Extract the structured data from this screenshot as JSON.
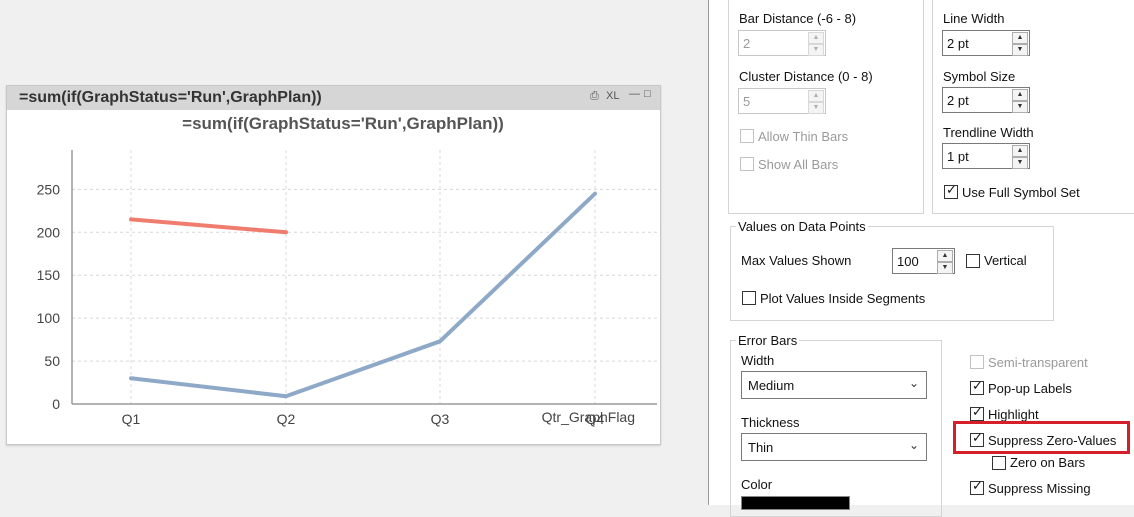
{
  "chart_window": {
    "title": "=sum(if(GraphStatus='Run',GraphPlan))",
    "icons": [
      "print-icon",
      "xl-icon",
      "minimize-icon",
      "maximize-icon"
    ],
    "xl_label": "XL"
  },
  "chart_data": {
    "type": "line",
    "title": "=sum(if(GraphStatus='Run',GraphPlan))",
    "xlabel": "Qtr_GraphFlag",
    "ylabel": "",
    "categories": [
      "Q1",
      "Q2",
      "Q3",
      "Q4"
    ],
    "yticks": [
      "0",
      "50",
      "100",
      "150",
      "200",
      "250"
    ],
    "ylim": [
      0,
      290
    ],
    "grid": true,
    "series": [
      {
        "color": "#ee7d6e",
        "values": [
          215,
          200,
          null,
          null
        ]
      },
      {
        "color": "#8da9c7",
        "values": [
          30,
          9,
          73,
          245
        ]
      }
    ]
  },
  "dialog": {
    "bar_settings": {
      "bar_distance_label": "Bar Distance (-6 - 8)",
      "bar_distance_value": "2",
      "cluster_distance_label": "Cluster Distance (0 - 8)",
      "cluster_distance_value": "5",
      "allow_thin_bars": "Allow Thin Bars",
      "show_all_bars": "Show All Bars"
    },
    "line_symbol": {
      "line_width_label": "Line Width",
      "line_width_value": "2 pt",
      "symbol_size_label": "Symbol Size",
      "symbol_size_value": "2 pt",
      "trendline_width_label": "Trendline Width",
      "trendline_width_value": "1 pt",
      "use_full_symbol_set": "Use Full Symbol Set"
    },
    "values_on_data_points": {
      "title": "Values on Data Points",
      "max_values_label": "Max Values Shown",
      "max_values_value": "100",
      "vertical_label": "Vertical",
      "plot_inside_label": "Plot Values Inside Segments"
    },
    "error_bars": {
      "title": "Error Bars",
      "width_label": "Width",
      "width_value": "Medium",
      "thickness_label": "Thickness",
      "thickness_value": "Thin",
      "color_label": "Color",
      "color_value": "#000000"
    },
    "options": {
      "semi_transparent": "Semi-transparent",
      "popup_labels": "Pop-up Labels",
      "highlight": "Highlight",
      "suppress_zero_values": "Suppress Zero-Values",
      "zero_on_bars": "Zero on Bars",
      "suppress_missing": "Suppress Missing"
    },
    "highlight_color": "#d4202a"
  }
}
